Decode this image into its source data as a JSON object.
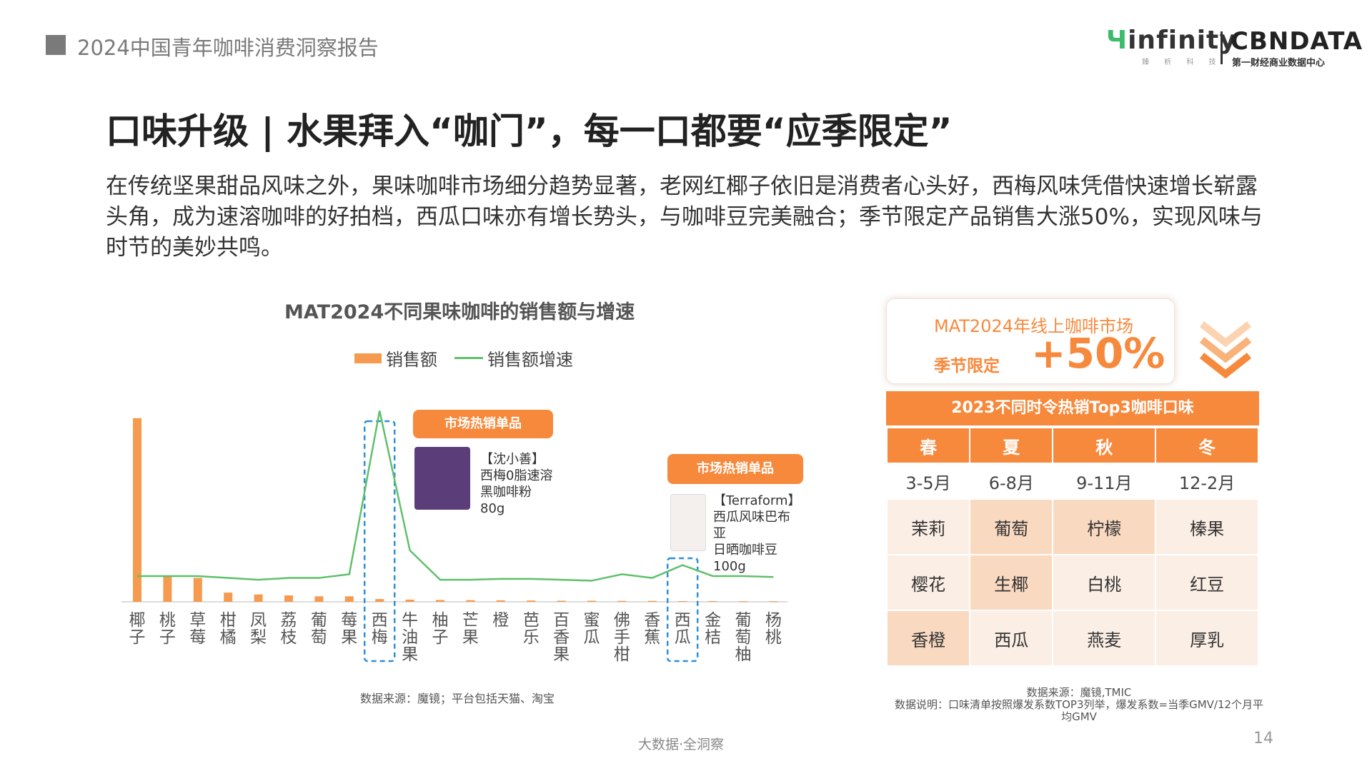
{
  "header": {
    "report_title": "2024中国青年咖啡消费洞察报告",
    "logo_infinity": "infinity",
    "logo_infinity_sub": "臻 析 科 技",
    "logo_cbn": "CBNDATA",
    "logo_cbn_sub": "第一财经商业数据中心"
  },
  "title": "口味升级 | 水果拜入“咖门”，每一口都要“应季限定”",
  "description": "在传统坚果甜品风味之外，果味咖啡市场细分趋势显著，老网红椰子依旧是消费者心头好，西梅风味凭借快速增长崭露头角，成为速溶咖啡的好拍档，西瓜口味亦有增长势头，与咖啡豆完美融合；季节限定产品销售大涨50%，实现风味与时节的美妙共鸣。",
  "chart_data": {
    "type": "bar",
    "title": "MAT2024不同果味咖啡的销售额与增速",
    "categories": [
      "椰子",
      "桃子",
      "草莓",
      "柑橘",
      "凤梨",
      "荔枝",
      "葡萄",
      "莓果",
      "西梅",
      "牛油果",
      "柚子",
      "芒果",
      "橙",
      "芭乐",
      "百香果",
      "蜜瓜",
      "佛手柑",
      "香蕉",
      "西瓜",
      "金桔",
      "葡萄柚",
      "杨桃"
    ],
    "series": [
      {
        "name": "销售额",
        "type": "bar",
        "values": [
          100,
          14,
          13,
          5,
          4,
          3.5,
          3,
          3,
          1.5,
          1.2,
          1,
          0.9,
          0.8,
          0.7,
          0.6,
          0.6,
          0.5,
          0.5,
          0.4,
          0.4,
          0.3,
          0.3
        ]
      },
      {
        "name": "销售额增速",
        "type": "line",
        "values": [
          14,
          14,
          14,
          13,
          12,
          13,
          13,
          15,
          104,
          28,
          12,
          12,
          12.5,
          12.5,
          12,
          11.5,
          15,
          13,
          20,
          14,
          14,
          13.5
        ]
      }
    ],
    "ylim": [
      0,
      110
    ],
    "legend": "top",
    "highlight": [
      "西梅",
      "西瓜"
    ]
  },
  "hot_products": {
    "tag": "市场热销单品",
    "product1": [
      "【沈小善】",
      "西梅0脂速溶",
      "黑咖啡粉",
      "80g"
    ],
    "product2": [
      "【Terraform】",
      "西瓜风味巴布",
      "亚",
      "日晒咖啡豆",
      "100g"
    ]
  },
  "source_left": "数据来源：魔镜；平台包括天猫、淘宝",
  "growth": {
    "label": "MAT2024年线上咖啡市场",
    "tag": "季节限定",
    "value": "+50%"
  },
  "season_table": {
    "title": "2023不同时令热销Top3咖啡口味",
    "seasons": [
      "春",
      "夏",
      "秋",
      "冬"
    ],
    "months": [
      "3-5月",
      "6-8月",
      "9-11月",
      "12-2月"
    ],
    "flavors": [
      [
        "茉莉",
        "葡萄",
        "柠檬",
        "榛果"
      ],
      [
        "樱花",
        "生椰",
        "白桃",
        "红豆"
      ],
      [
        "香橙",
        "西瓜",
        "燕麦",
        "厚乳"
      ]
    ]
  },
  "source_right": {
    "line1": "数据来源：魔镜,TMIC",
    "line2": "数据说明：口味清单按照爆发系数TOP3列举，爆发系数=当季GMV/12个月平均GMV"
  },
  "footer": {
    "text": "大数据·全洞察",
    "page": "14"
  },
  "colors": {
    "accent": "#f7893c",
    "bar": "#f59a4f",
    "line": "#5fc06b",
    "highlight": "#2d8fd8"
  }
}
